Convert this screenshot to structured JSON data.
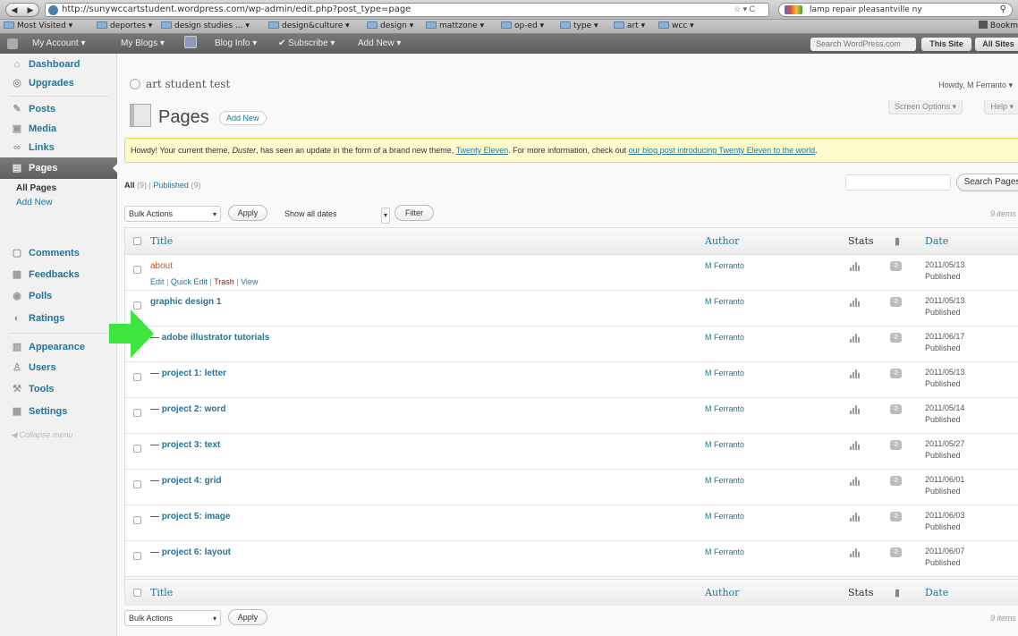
{
  "browser": {
    "back": "◀",
    "forward": "▶",
    "url": "http://sunywccartstudent.wordpress.com/wp-admin/edit.php?post_type=page",
    "url_tools": "☆ ▾  C",
    "search_query": "lamp repair pleasantville ny",
    "search_icon": "magnifier-icon"
  },
  "bookmarks": [
    {
      "label": "Most Visited ▾"
    },
    {
      "label": "deportes ▾"
    },
    {
      "label": "design studies ... ▾"
    },
    {
      "label": "design&culture ▾"
    },
    {
      "label": "design ▾"
    },
    {
      "label": "mattzone ▾"
    },
    {
      "label": "op-ed ▾"
    },
    {
      "label": "type ▾"
    },
    {
      "label": "art ▾"
    },
    {
      "label": "wcc ▾"
    }
  ],
  "bookmarks_right": "Bookm",
  "adminbar": {
    "my_account": "My Account ▾",
    "my_blogs": "My Blogs ▾",
    "blog_info": "Blog Info ▾",
    "subscribe": "Subscribe ▾",
    "add_new": "Add New ▾",
    "search_placeholder": "Search WordPress.com",
    "this_site": "This Site",
    "all_sites": "All Sites"
  },
  "sidebar": {
    "items": [
      {
        "label": "Dashboard",
        "icon": "⌂"
      },
      {
        "label": "Upgrades",
        "icon": "◎"
      },
      {
        "label": "Posts",
        "icon": "✎"
      },
      {
        "label": "Media",
        "icon": "▣"
      },
      {
        "label": "Links",
        "icon": "∞"
      },
      {
        "label": "Pages",
        "icon": "▤"
      },
      {
        "label": "Comments",
        "icon": "▢"
      },
      {
        "label": "Feedbacks",
        "icon": "▦"
      },
      {
        "label": "Polls",
        "icon": "◉"
      },
      {
        "label": "Ratings",
        "icon": "◐"
      },
      {
        "label": "Appearance",
        "icon": "▥"
      },
      {
        "label": "Users",
        "icon": "♙"
      },
      {
        "label": "Tools",
        "icon": "⚒"
      },
      {
        "label": "Settings",
        "icon": "▩"
      }
    ],
    "sub_all_pages": "All Pages",
    "sub_add_new": "Add New",
    "collapse": "Collapse menu"
  },
  "header": {
    "site_title": "art student test",
    "howdy": "Howdy, M Ferranto ▾",
    "page_title": "Pages",
    "add_new": "Add New",
    "screen_options": "Screen Options ▾",
    "help": "Help ▾"
  },
  "notice": {
    "text_1": "Howdy! Your current theme, ",
    "theme": "Duster",
    "text_2": ", has seen an update in the form of a brand new theme, ",
    "link_1": "Twenty Eleven",
    "text_3": ". For more information, check out ",
    "link_2": "our blog post introducing Twenty Eleven to the world",
    "text_4": "."
  },
  "filters": {
    "all": "All",
    "all_count": "(9)",
    "sep": "|",
    "published": "Published",
    "published_count": "(9)",
    "bulk_actions": "Bulk Actions",
    "apply": "Apply",
    "dates": "Show all dates",
    "filter": "Filter",
    "search_button": "Search Pages",
    "items_count": "9 items"
  },
  "table": {
    "col_title": "Title",
    "col_author": "Author",
    "col_stats": "Stats",
    "col_comments_icon": "comment-bubble-icon",
    "col_date": "Date",
    "rows": [
      {
        "title": "about",
        "author": "M Ferranto",
        "date": "2011/05/13",
        "status": "Published",
        "comments": "0"
      },
      {
        "title": "graphic design 1",
        "author": "M Ferranto",
        "date": "2011/05/13",
        "status": "Published",
        "comments": "0"
      },
      {
        "title": "— adobe illustrator tutorials",
        "author": "M Ferranto",
        "date": "2011/06/17",
        "status": "Published",
        "comments": "0"
      },
      {
        "title": "— project 1: letter",
        "author": "M Ferranto",
        "date": "2011/05/13",
        "status": "Published",
        "comments": "0"
      },
      {
        "title": "— project 2: word",
        "author": "M Ferranto",
        "date": "2011/05/14",
        "status": "Published",
        "comments": "0"
      },
      {
        "title": "— project 3: text",
        "author": "M Ferranto",
        "date": "2011/05/27",
        "status": "Published",
        "comments": "0"
      },
      {
        "title": "— project 4: grid",
        "author": "M Ferranto",
        "date": "2011/06/01",
        "status": "Published",
        "comments": "0"
      },
      {
        "title": "— project 5: image",
        "author": "M Ferranto",
        "date": "2011/06/03",
        "status": "Published",
        "comments": "0"
      },
      {
        "title": "— project 6: layout",
        "author": "M Ferranto",
        "date": "2011/06/07",
        "status": "Published",
        "comments": "0"
      }
    ],
    "row_actions": {
      "edit": "Edit",
      "quick_edit": "Quick Edit",
      "trash": "Trash",
      "view": "View",
      "sep": " | "
    }
  },
  "colors": {
    "link": "#21759b",
    "hover_title": "#d54e21",
    "notice_bg": "#fffbcc",
    "arrow": "#3ee53e"
  },
  "annotation": {
    "icon": "green-arrow-icon"
  }
}
